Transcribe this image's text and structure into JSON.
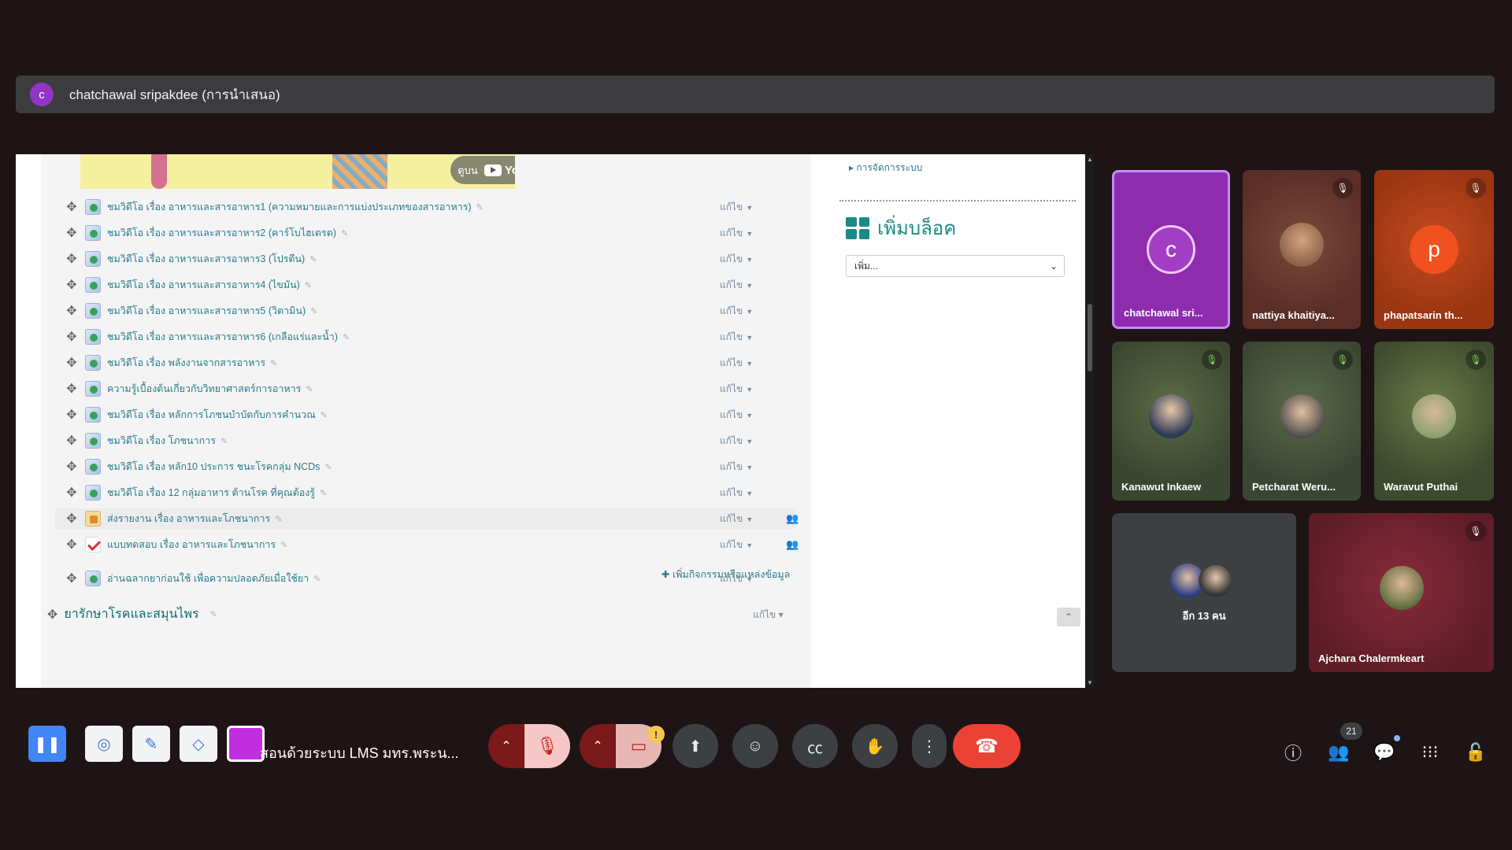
{
  "presenter": {
    "avatar_letter": "c",
    "name": "chatchawal sripakdee (การนำเสนอ)"
  },
  "shared_screen": {
    "video_banner": {
      "watch_on": "ดูบน",
      "brand": "YouTube"
    },
    "items": [
      {
        "label": "ชมวิดีโอ เรื่อง อาหารและสารอาหาร1 (ความหมายและการแบ่งประเภทของสารอาหาร)",
        "edit": "แก้ไข",
        "icon": "video-resource-icon"
      },
      {
        "label": "ชมวิดีโอ เรื่อง อาหารและสารอาหาร2 (คาร์โบไฮเดรต)",
        "edit": "แก้ไข",
        "icon": "video-resource-icon"
      },
      {
        "label": "ชมวิดีโอ เรื่อง อาหารและสารอาหาร3 (โปรตีน)",
        "edit": "แก้ไข",
        "icon": "video-resource-icon"
      },
      {
        "label": "ชมวิดีโอ เรื่อง อาหารและสารอาหาร4 (ไขมัน)",
        "edit": "แก้ไข",
        "icon": "video-resource-icon"
      },
      {
        "label": "ชมวิดีโอ เรื่อง อาหารและสารอาหาร5 (วิตามิน)",
        "edit": "แก้ไข",
        "icon": "video-resource-icon"
      },
      {
        "label": "ชมวิดีโอ เรื่อง อาหารและสารอาหาร6 (เกลือแร่และน้ำ)",
        "edit": "แก้ไข",
        "icon": "video-resource-icon"
      },
      {
        "label": "ชมวิดีโอ เรื่อง พลังงานจากสารอาหาร",
        "edit": "แก้ไข",
        "icon": "video-resource-icon"
      },
      {
        "label": "ความรู้เบื้องต้นเกี่ยวกับวิทยาศาสตร์การอาหาร",
        "edit": "แก้ไข",
        "icon": "video-resource-icon"
      },
      {
        "label": "ชมวิดีโอ เรื่อง หลักการโภชนบำบัดกับการคำนวณ",
        "edit": "แก้ไข",
        "icon": "video-resource-icon"
      },
      {
        "label": "ชมวิดีโอ เรื่อง โภชนาการ",
        "edit": "แก้ไข",
        "icon": "video-resource-icon"
      },
      {
        "label": "ชมวิดีโอ เรื่อง หลัก10 ประการ ชนะโรคกลุ่ม NCDs",
        "edit": "แก้ไข",
        "icon": "video-resource-icon"
      },
      {
        "label": "ชมวิดีโอ เรื่อง 12 กลุ่มอาหาร ต้านโรค ที่คุณต้องรู้",
        "edit": "แก้ไข",
        "icon": "video-resource-icon"
      },
      {
        "label": "ส่งรายงาน เรื่อง อาหารและโภชนาการ",
        "edit": "แก้ไข",
        "icon": "assignment-icon"
      },
      {
        "label": "แบบทดสอบ เรื่อง อาหารและโภชนาการ",
        "edit": "แก้ไข",
        "icon": "quiz-icon"
      }
    ],
    "add_activity": "เพิ่มกิจกรรมหรือแหล่งข้อมูล",
    "section": {
      "title": "ยารักษาโรคและสมุนไพร",
      "edit": "แก้ไข"
    },
    "next_section_item": {
      "label": "อ่านฉลากยาก่อนใช้ เพื่อความปลอดภัยเมื่อใช้ยา",
      "edit": "แก้ไข"
    },
    "right_panel": {
      "admin_link": "การจัดการระบบ",
      "add_block_title": "เพิ่มบล็อค",
      "add_block_select": "เพิ่ม..."
    }
  },
  "participants": [
    {
      "name": "chatchawal sri...",
      "avatar_letter": "c",
      "muted": false,
      "color": "#8e24aa"
    },
    {
      "name": "nattiya khaitiya...",
      "muted": true,
      "mute_style": "red"
    },
    {
      "name": "phapatsarin th...",
      "avatar_letter": "p",
      "muted": true,
      "mute_style": "red"
    },
    {
      "name": "Kanawut Inkaew",
      "muted": true,
      "mute_style": "green"
    },
    {
      "name": "Petcharat Weru...",
      "muted": true,
      "mute_style": "green"
    },
    {
      "name": "Waravut Puthai",
      "muted": true,
      "mute_style": "green"
    },
    {
      "name": "อีก 13 คน"
    },
    {
      "name": "Ajchara Chalermkeart",
      "muted": true,
      "mute_style": "red"
    }
  ],
  "controls": {
    "meeting_title": "สอนด้วยระบบ LMS มทร.พระน...",
    "people_count": "21",
    "annotation_color": "#c12ee0",
    "pause_icon": "pause-icon",
    "mic_icon": "mic-off-icon",
    "camera_icon": "camera-off-icon",
    "warning_mark": "!"
  }
}
